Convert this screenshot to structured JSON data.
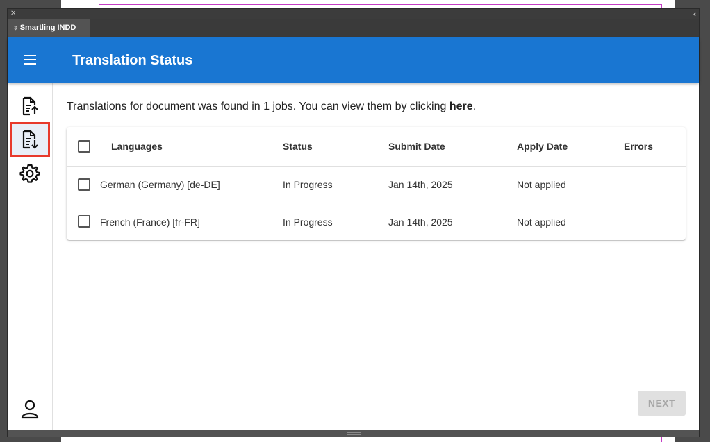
{
  "panel": {
    "tab_label": "Smartling INDD"
  },
  "appbar": {
    "title": "Translation Status",
    "menu_icon": "hamburger-menu-icon"
  },
  "sidenav": {
    "items": [
      {
        "name": "upload-document-icon",
        "active": false
      },
      {
        "name": "download-document-icon",
        "active": true
      },
      {
        "name": "settings-gear-icon",
        "active": false
      }
    ],
    "profile_icon": "user-profile-icon"
  },
  "main": {
    "info_prefix": "Translations for document was found in 1 jobs. You can view them by clicking ",
    "info_link": "here",
    "info_suffix": ".",
    "table": {
      "headers": {
        "languages": "Languages",
        "status": "Status",
        "submit_date": "Submit Date",
        "apply_date": "Apply Date",
        "errors": "Errors"
      },
      "rows": [
        {
          "language": "German (Germany) [de-DE]",
          "status": "In Progress",
          "submit_date": "Jan 14th, 2025",
          "apply_date": "Not applied",
          "errors": ""
        },
        {
          "language": "French (France) [fr-FR]",
          "status": "In Progress",
          "submit_date": "Jan 14th, 2025",
          "apply_date": "Not applied",
          "errors": ""
        }
      ]
    },
    "next_label": "NEXT"
  },
  "colors": {
    "appbar": "#1976d2",
    "active_highlight": "#e8392b",
    "disabled_button": "#e0e0e0"
  }
}
